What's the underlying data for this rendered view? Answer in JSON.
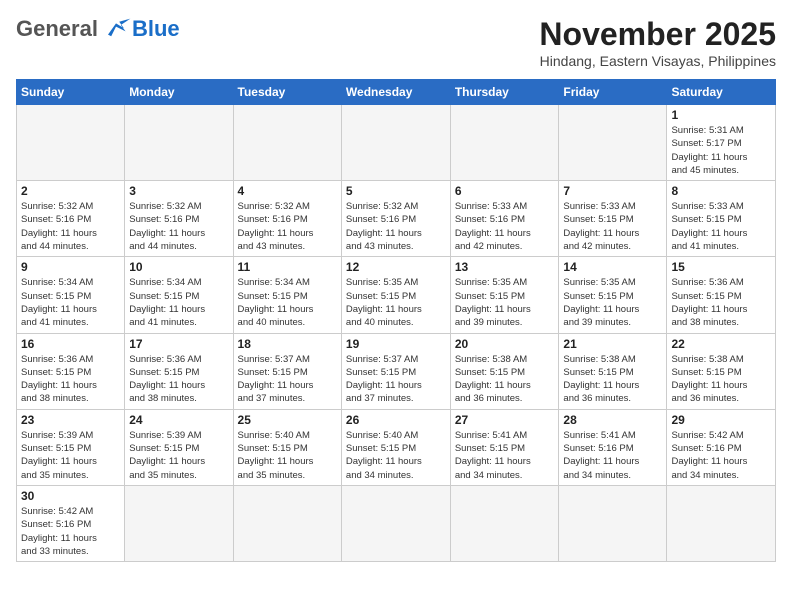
{
  "header": {
    "logo_general": "General",
    "logo_blue": "Blue",
    "month": "November 2025",
    "location": "Hindang, Eastern Visayas, Philippines"
  },
  "weekdays": [
    "Sunday",
    "Monday",
    "Tuesday",
    "Wednesday",
    "Thursday",
    "Friday",
    "Saturday"
  ],
  "weeks": [
    [
      {
        "day": "",
        "info": ""
      },
      {
        "day": "",
        "info": ""
      },
      {
        "day": "",
        "info": ""
      },
      {
        "day": "",
        "info": ""
      },
      {
        "day": "",
        "info": ""
      },
      {
        "day": "",
        "info": ""
      },
      {
        "day": "1",
        "info": "Sunrise: 5:31 AM\nSunset: 5:17 PM\nDaylight: 11 hours\nand 45 minutes."
      }
    ],
    [
      {
        "day": "2",
        "info": "Sunrise: 5:32 AM\nSunset: 5:16 PM\nDaylight: 11 hours\nand 44 minutes."
      },
      {
        "day": "3",
        "info": "Sunrise: 5:32 AM\nSunset: 5:16 PM\nDaylight: 11 hours\nand 44 minutes."
      },
      {
        "day": "4",
        "info": "Sunrise: 5:32 AM\nSunset: 5:16 PM\nDaylight: 11 hours\nand 43 minutes."
      },
      {
        "day": "5",
        "info": "Sunrise: 5:32 AM\nSunset: 5:16 PM\nDaylight: 11 hours\nand 43 minutes."
      },
      {
        "day": "6",
        "info": "Sunrise: 5:33 AM\nSunset: 5:16 PM\nDaylight: 11 hours\nand 42 minutes."
      },
      {
        "day": "7",
        "info": "Sunrise: 5:33 AM\nSunset: 5:15 PM\nDaylight: 11 hours\nand 42 minutes."
      },
      {
        "day": "8",
        "info": "Sunrise: 5:33 AM\nSunset: 5:15 PM\nDaylight: 11 hours\nand 41 minutes."
      }
    ],
    [
      {
        "day": "9",
        "info": "Sunrise: 5:34 AM\nSunset: 5:15 PM\nDaylight: 11 hours\nand 41 minutes."
      },
      {
        "day": "10",
        "info": "Sunrise: 5:34 AM\nSunset: 5:15 PM\nDaylight: 11 hours\nand 41 minutes."
      },
      {
        "day": "11",
        "info": "Sunrise: 5:34 AM\nSunset: 5:15 PM\nDaylight: 11 hours\nand 40 minutes."
      },
      {
        "day": "12",
        "info": "Sunrise: 5:35 AM\nSunset: 5:15 PM\nDaylight: 11 hours\nand 40 minutes."
      },
      {
        "day": "13",
        "info": "Sunrise: 5:35 AM\nSunset: 5:15 PM\nDaylight: 11 hours\nand 39 minutes."
      },
      {
        "day": "14",
        "info": "Sunrise: 5:35 AM\nSunset: 5:15 PM\nDaylight: 11 hours\nand 39 minutes."
      },
      {
        "day": "15",
        "info": "Sunrise: 5:36 AM\nSunset: 5:15 PM\nDaylight: 11 hours\nand 38 minutes."
      }
    ],
    [
      {
        "day": "16",
        "info": "Sunrise: 5:36 AM\nSunset: 5:15 PM\nDaylight: 11 hours\nand 38 minutes."
      },
      {
        "day": "17",
        "info": "Sunrise: 5:36 AM\nSunset: 5:15 PM\nDaylight: 11 hours\nand 38 minutes."
      },
      {
        "day": "18",
        "info": "Sunrise: 5:37 AM\nSunset: 5:15 PM\nDaylight: 11 hours\nand 37 minutes."
      },
      {
        "day": "19",
        "info": "Sunrise: 5:37 AM\nSunset: 5:15 PM\nDaylight: 11 hours\nand 37 minutes."
      },
      {
        "day": "20",
        "info": "Sunrise: 5:38 AM\nSunset: 5:15 PM\nDaylight: 11 hours\nand 36 minutes."
      },
      {
        "day": "21",
        "info": "Sunrise: 5:38 AM\nSunset: 5:15 PM\nDaylight: 11 hours\nand 36 minutes."
      },
      {
        "day": "22",
        "info": "Sunrise: 5:38 AM\nSunset: 5:15 PM\nDaylight: 11 hours\nand 36 minutes."
      }
    ],
    [
      {
        "day": "23",
        "info": "Sunrise: 5:39 AM\nSunset: 5:15 PM\nDaylight: 11 hours\nand 35 minutes."
      },
      {
        "day": "24",
        "info": "Sunrise: 5:39 AM\nSunset: 5:15 PM\nDaylight: 11 hours\nand 35 minutes."
      },
      {
        "day": "25",
        "info": "Sunrise: 5:40 AM\nSunset: 5:15 PM\nDaylight: 11 hours\nand 35 minutes."
      },
      {
        "day": "26",
        "info": "Sunrise: 5:40 AM\nSunset: 5:15 PM\nDaylight: 11 hours\nand 34 minutes."
      },
      {
        "day": "27",
        "info": "Sunrise: 5:41 AM\nSunset: 5:15 PM\nDaylight: 11 hours\nand 34 minutes."
      },
      {
        "day": "28",
        "info": "Sunrise: 5:41 AM\nSunset: 5:16 PM\nDaylight: 11 hours\nand 34 minutes."
      },
      {
        "day": "29",
        "info": "Sunrise: 5:42 AM\nSunset: 5:16 PM\nDaylight: 11 hours\nand 34 minutes."
      }
    ],
    [
      {
        "day": "30",
        "info": "Sunrise: 5:42 AM\nSunset: 5:16 PM\nDaylight: 11 hours\nand 33 minutes."
      },
      {
        "day": "",
        "info": ""
      },
      {
        "day": "",
        "info": ""
      },
      {
        "day": "",
        "info": ""
      },
      {
        "day": "",
        "info": ""
      },
      {
        "day": "",
        "info": ""
      },
      {
        "day": "",
        "info": ""
      }
    ]
  ]
}
